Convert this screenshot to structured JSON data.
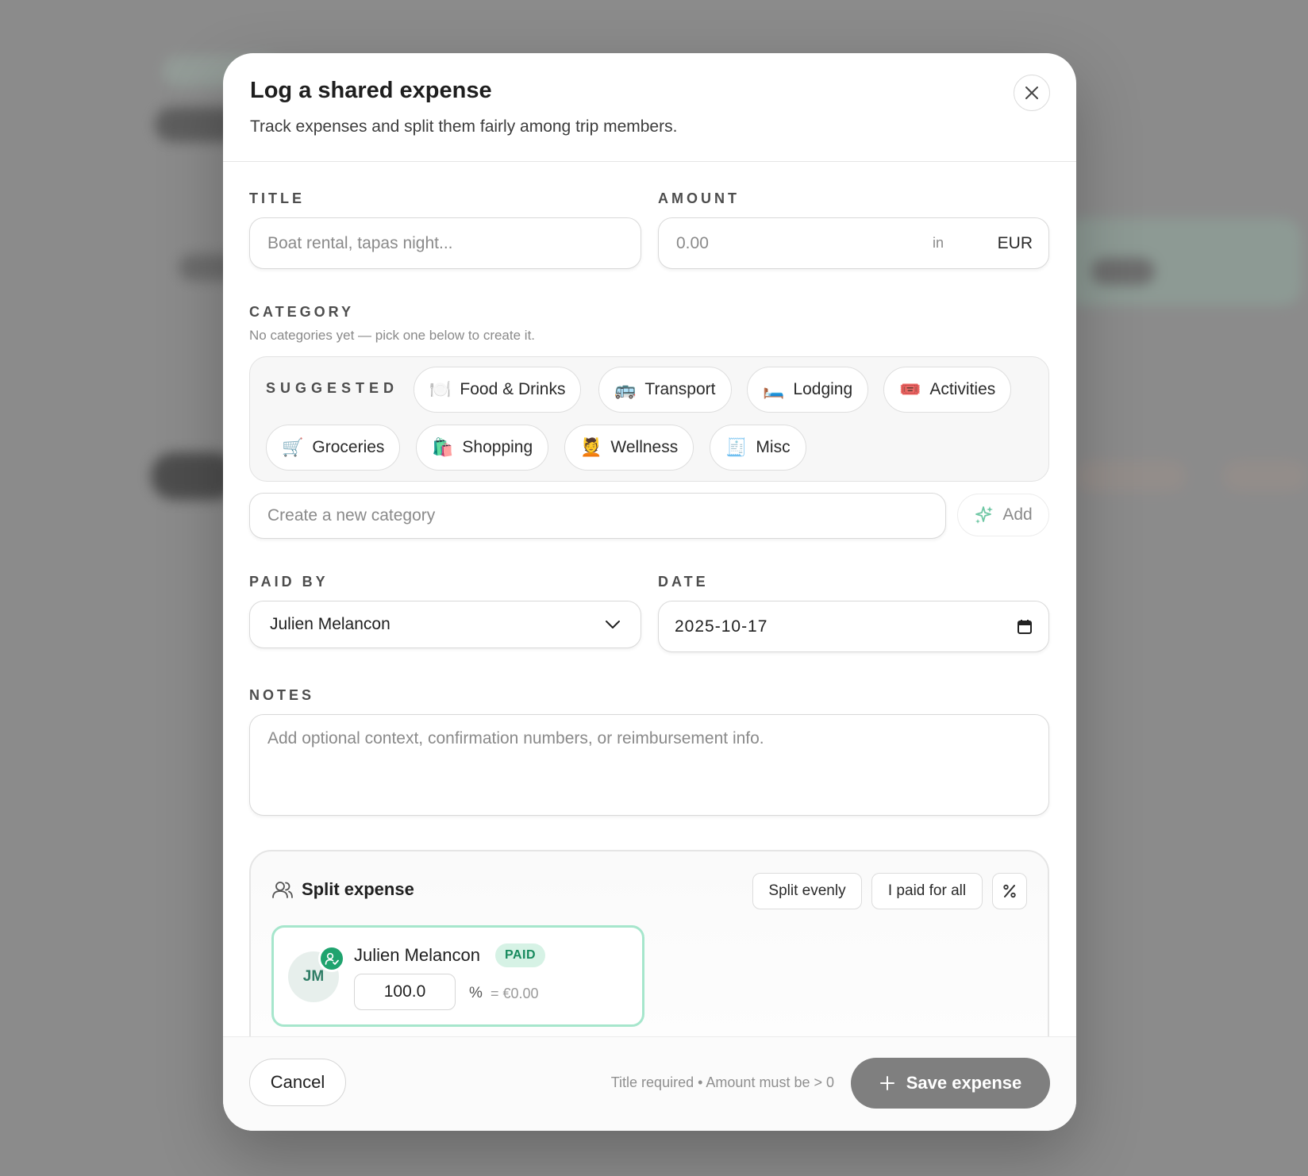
{
  "modal": {
    "title": "Log a shared expense",
    "subtitle": "Track expenses and split them fairly among trip members."
  },
  "form": {
    "title_label": "TITLE",
    "title_placeholder": "Boat rental, tapas night...",
    "amount_label": "AMOUNT",
    "amount_placeholder": "0.00",
    "amount_in": "in",
    "currency": "EUR",
    "category_label": "CATEGORY",
    "category_hint": "No categories yet — pick one below to create it.",
    "suggested_label": "SUGGESTED",
    "suggested": [
      {
        "emoji": "🍽️",
        "label": "Food & Drinks"
      },
      {
        "emoji": "🚌",
        "label": "Transport"
      },
      {
        "emoji": "🛏️",
        "label": "Lodging"
      },
      {
        "emoji": "🎟️",
        "label": "Activities"
      },
      {
        "emoji": "🛒",
        "label": "Groceries"
      },
      {
        "emoji": "🛍️",
        "label": "Shopping"
      },
      {
        "emoji": "💆",
        "label": "Wellness"
      },
      {
        "emoji": "🧾",
        "label": "Misc"
      }
    ],
    "new_category_placeholder": "Create a new category",
    "add_label": "Add",
    "paid_by_label": "PAID BY",
    "paid_by_value": "Julien Melancon",
    "date_label": "DATE",
    "date_value": "2025-10-17",
    "notes_label": "NOTES",
    "notes_placeholder": "Add optional context, confirmation numbers, or reimbursement info."
  },
  "split": {
    "title": "Split expense",
    "split_evenly": "Split evenly",
    "paid_for_all": "I paid for all",
    "percent_toggle": "%",
    "members": [
      {
        "initials": "JM",
        "name": "Julien Melancon",
        "badge": "PAID",
        "percent": "100.0",
        "percent_sign": "%",
        "amount": "= €0.00"
      }
    ]
  },
  "footer": {
    "cancel": "Cancel",
    "hint": "Title required • Amount must be > 0",
    "save": "Save expense"
  },
  "colors": {
    "accent_green": "#1fa36e",
    "paid_badge_bg": "#d6f2e5",
    "save_button_bg": "#7f7f7f"
  }
}
